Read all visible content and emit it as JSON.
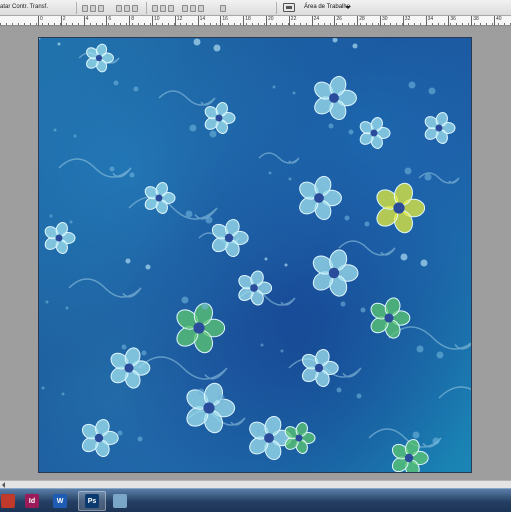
{
  "options_bar": {
    "label": "atar Contr. Transf.",
    "workspace_label": "Área de Trabalho"
  },
  "ruler": {
    "labels": [
      "0",
      "2",
      "4",
      "6",
      "8",
      "10",
      "12",
      "14",
      "16",
      "18",
      "20",
      "22",
      "24",
      "26",
      "28",
      "30",
      "32",
      "34",
      "36",
      "38",
      "40"
    ]
  },
  "taskbar": {
    "apps": [
      {
        "name": "adobe-app-icon",
        "glyph": "",
        "color": "#c0392b"
      },
      {
        "name": "indesign-icon",
        "glyph": "Id",
        "color": "#9b1b5a"
      },
      {
        "name": "word-icon",
        "glyph": "W",
        "color": "#1e5cb3"
      },
      {
        "name": "photoshop-icon",
        "glyph": "Ps",
        "color": "#0b3a6e"
      },
      {
        "name": "image-viewer-icon",
        "glyph": "",
        "color": "#7aa7c7"
      }
    ]
  },
  "colors": {
    "canvas_base": "#1a4f96",
    "flower_light": "#9fe0ee",
    "flower_yellow": "#e6ec3a",
    "flower_green": "#5cc870"
  }
}
